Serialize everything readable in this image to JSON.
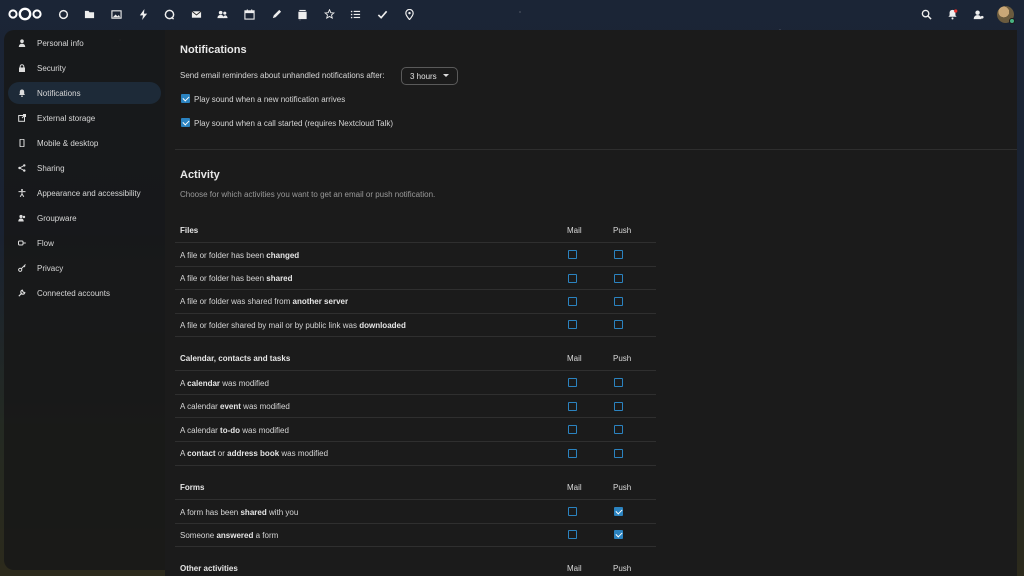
{
  "header": {
    "apps": [
      "dashboard-icon",
      "files-icon",
      "photos-icon",
      "activity-icon",
      "talk-icon",
      "mail-icon",
      "contacts-icon",
      "calendar-icon",
      "notes-icon",
      "deck-icon",
      "app-store-icon",
      "tasks-icon",
      "checklist-icon",
      "maps-icon"
    ],
    "right": [
      "search-icon",
      "notifications-icon",
      "contacts-menu-icon"
    ]
  },
  "sidebar": {
    "items": [
      {
        "label": "Personal info",
        "icon": "person-icon"
      },
      {
        "label": "Security",
        "icon": "lock-icon"
      },
      {
        "label": "Notifications",
        "icon": "bell-icon",
        "active": true
      },
      {
        "label": "External storage",
        "icon": "external-link-icon"
      },
      {
        "label": "Mobile & desktop",
        "icon": "phone-icon"
      },
      {
        "label": "Sharing",
        "icon": "share-icon"
      },
      {
        "label": "Appearance and accessibility",
        "icon": "accessibility-icon"
      },
      {
        "label": "Groupware",
        "icon": "groupware-icon"
      },
      {
        "label": "Flow",
        "icon": "flow-icon"
      },
      {
        "label": "Privacy",
        "icon": "key-icon"
      },
      {
        "label": "Connected accounts",
        "icon": "wrench-icon"
      }
    ]
  },
  "notifications": {
    "title": "Notifications",
    "reminder_label": "Send email reminders about unhandled notifications after:",
    "reminder_value": "3 hours",
    "sound_notification": {
      "label": "Play sound when a new notification arrives",
      "checked": true
    },
    "sound_call": {
      "label": "Play sound when a call started (requires Nextcloud Talk)",
      "checked": true
    }
  },
  "activity": {
    "title": "Activity",
    "subtitle": "Choose for which activities you want to get an email or push notification.",
    "col_mail": "Mail",
    "col_push": "Push",
    "groups": [
      {
        "name": "Files",
        "rows": [
          {
            "pre": "A file or folder has been ",
            "bold": "changed",
            "post": "",
            "mail": false,
            "push": false
          },
          {
            "pre": "A file or folder has been ",
            "bold": "shared",
            "post": "",
            "mail": false,
            "push": false
          },
          {
            "pre": "A file or folder was shared from ",
            "bold": "another server",
            "post": "",
            "mail": false,
            "push": false
          },
          {
            "pre": "A file or folder shared by mail or by public link was ",
            "bold": "downloaded",
            "post": "",
            "mail": false,
            "push": false
          }
        ]
      },
      {
        "name": "Calendar, contacts and tasks",
        "rows": [
          {
            "pre": "A ",
            "bold": "calendar",
            "post": " was modified",
            "mail": false,
            "push": false
          },
          {
            "pre": "A calendar ",
            "bold": "event",
            "post": " was modified",
            "mail": false,
            "push": false
          },
          {
            "pre": "A calendar ",
            "bold": "to-do",
            "post": " was modified",
            "mail": false,
            "push": false
          },
          {
            "pre": "A ",
            "bold": "contact",
            "mid": " or ",
            "bold2": "address book",
            "post": " was modified",
            "mail": false,
            "push": false
          }
        ]
      },
      {
        "name": "Forms",
        "rows": [
          {
            "pre": "A form has been ",
            "bold": "shared",
            "post": " with you",
            "mail": false,
            "push": true
          },
          {
            "pre": "Someone ",
            "bold": "answered",
            "post": " a form",
            "mail": false,
            "push": true
          }
        ]
      },
      {
        "name": "Other activities",
        "rows": []
      }
    ]
  }
}
